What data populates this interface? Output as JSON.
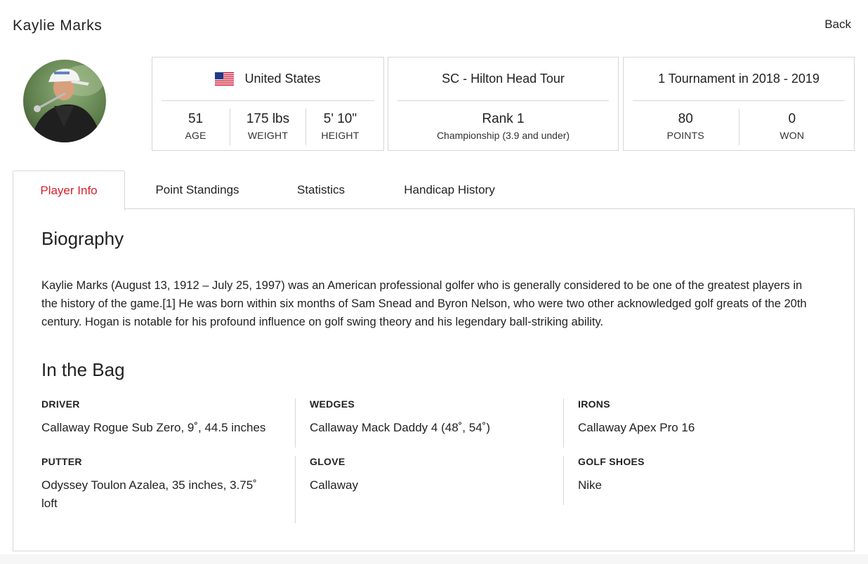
{
  "header": {
    "player_name": "Kaylie Marks",
    "back_label": "Back"
  },
  "country_card": {
    "country": "United States",
    "stats": [
      {
        "value": "51",
        "label": "AGE"
      },
      {
        "value": "175 lbs",
        "label": "WEIGHT"
      },
      {
        "value": "5' 10\"",
        "label": "HEIGHT"
      }
    ]
  },
  "tour_card": {
    "tour": "SC - Hilton Head Tour",
    "rank": "Rank 1",
    "division": "Championship (3.9 and under)"
  },
  "tournament_card": {
    "title": "1 Tournament in 2018 - 2019",
    "stats": [
      {
        "value": "80",
        "label": "POINTS"
      },
      {
        "value": "0",
        "label": "WON"
      }
    ]
  },
  "tabs": [
    {
      "label": "Player Info",
      "active": true
    },
    {
      "label": "Point Standings",
      "active": false
    },
    {
      "label": "Statistics",
      "active": false
    },
    {
      "label": "Handicap History",
      "active": false
    }
  ],
  "biography": {
    "title": "Biography",
    "text": "Kaylie Marks (August 13, 1912 – July 25, 1997) was an American professional golfer who is generally considered to be one of the greatest players in the history of the game.[1] He was born within six months of Sam Snead and Byron Nelson, who were two other acknowledged golf greats of the 20th century. Hogan is notable for his profound influence on golf swing theory and his legendary ball-striking ability."
  },
  "bag": {
    "title": "In the Bag",
    "items": [
      {
        "label": "DRIVER",
        "value": "Callaway Rogue Sub Zero, 9˚, 44.5 inches"
      },
      {
        "label": "WEDGES",
        "value": "Callaway Mack Daddy 4 (48˚, 54˚)"
      },
      {
        "label": "IRONS",
        "value": "Callaway Apex Pro 16"
      },
      {
        "label": "PUTTER",
        "value": "Odyssey Toulon Azalea, 35 inches, 3.75˚ loft"
      },
      {
        "label": "GLOVE",
        "value": "Callaway"
      },
      {
        "label": "GOLF SHOES",
        "value": "Nike"
      }
    ]
  },
  "colors": {
    "accent": "#d8202c",
    "border": "#d6d6d6",
    "text": "#222222"
  },
  "icons": {
    "flag": "us-flag-icon",
    "avatar": "player-avatar"
  }
}
